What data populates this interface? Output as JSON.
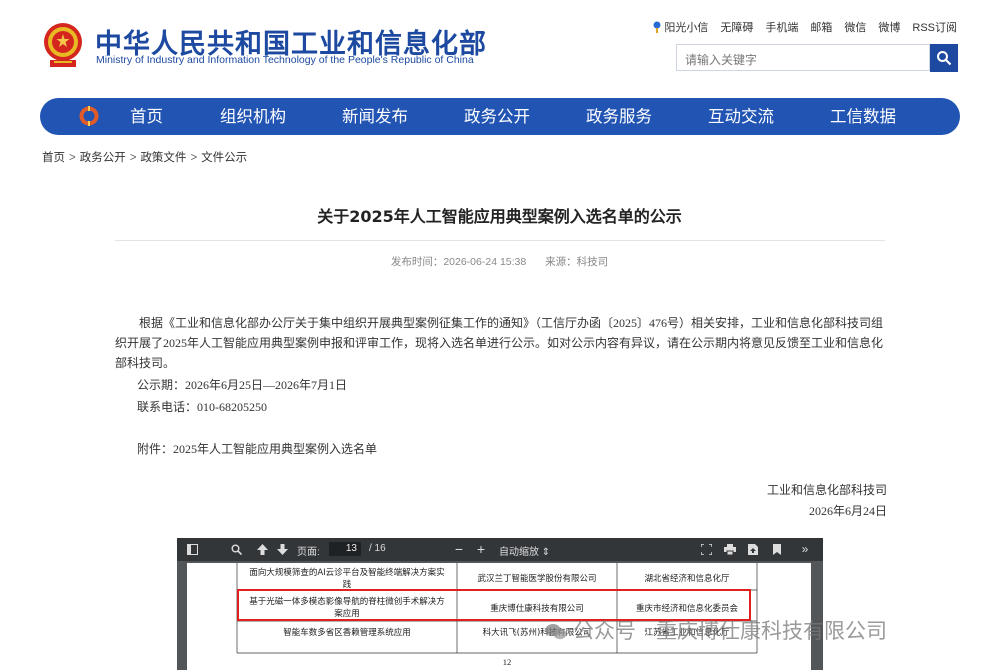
{
  "header": {
    "title": "中华人民共和国工业和信息化部",
    "subtitle": "Ministry of Industry and Information Technology of the People's Republic of China",
    "links": [
      "阳光小信",
      "无障碍",
      "手机端",
      "邮箱",
      "微信",
      "微博",
      "RSS订阅"
    ],
    "search_placeholder": "请输入关键字"
  },
  "nav": {
    "items": [
      "首页",
      "组织机构",
      "新闻发布",
      "政务公开",
      "政务服务",
      "互动交流",
      "工信数据"
    ]
  },
  "breadcrumb": [
    "首页",
    "政务公开",
    "政策文件",
    "文件公示"
  ],
  "breadcrumb_sep": ">",
  "article": {
    "title": "关于2025年人工智能应用典型案例入选名单的公示",
    "publish_label": "发布时间：2026-06-24 15:38",
    "source_label": "来源：科技司",
    "para1": "根据《工业和信息化部办公厅关于集中组织开展典型案例征集工作的通知》（工信厅办函〔2025〕476号）相关安排，工业和信息化部科技司组织开展了2025年人工智能应用典型案例申报和评审工作，现将入选名单进行公示。如对公示内容有异议，请在公示期内将意见反馈至工业和信息化部科技司。",
    "period": "公示期：2026年6月25日—2026年7月1日",
    "phone": "联系电话：010-68205250",
    "attachment": "附件：2025年人工智能应用典型案例入选名单",
    "signature_org": "工业和信息化部科技司",
    "signature_date": "2026年6月24日"
  },
  "pdf_viewer": {
    "page_label": "页面:",
    "page_current": "13",
    "page_total": "/ 16",
    "zoom_label": "自动缩放",
    "rows": [
      {
        "case": "面向大规模筛查的AI云诊平台及智能终端解决方案实践",
        "company": "武汉兰丁智能医学股份有限公司",
        "recommender": "湖北省经济和信息化厅"
      },
      {
        "case": "基于光磁一体多模态影像导航的脊柱微创手术解决方案应用",
        "company": "重庆博仕康科技有限公司",
        "recommender": "重庆市经济和信息化委员会"
      },
      {
        "case": "智能车数多省区香赖管理系统应用",
        "company": "科大讯飞(苏州)科技有限公司",
        "recommender": "江苏省工业和信息化厅"
      }
    ],
    "page_number": "12"
  },
  "watermark": "公众号 · 重庆博仕康科技有限公司",
  "colors": {
    "brand": "#1d4aa0",
    "nav": "#2255b3",
    "highlight": "#e0201c"
  }
}
